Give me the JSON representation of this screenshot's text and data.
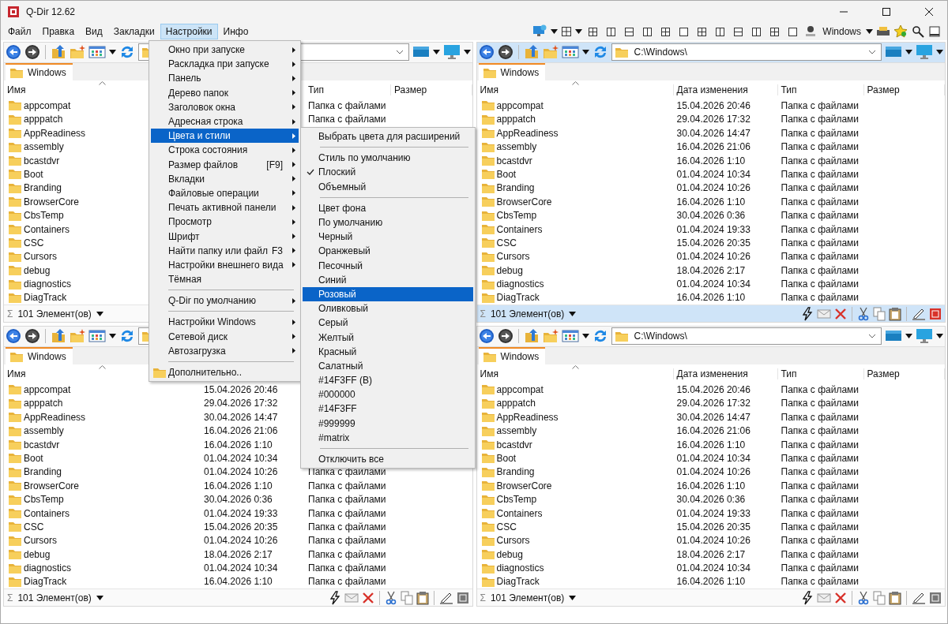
{
  "window": {
    "title": "Q-Dir 12.62"
  },
  "menu_bar": [
    {
      "label": "Файл",
      "selected": false
    },
    {
      "label": "Правка",
      "selected": false
    },
    {
      "label": "Вид",
      "selected": false
    },
    {
      "label": "Закладки",
      "selected": false
    },
    {
      "label": "Настройки",
      "selected": true
    },
    {
      "label": "Инфо",
      "selected": false
    }
  ],
  "toolbar": {
    "profile_label": "Windows"
  },
  "panes": [
    {
      "active": false,
      "tab": "Windows",
      "columns": [
        {
          "kind": "name",
          "label": "Имя"
        },
        {
          "kind": "type",
          "label": "Тип"
        },
        {
          "kind": "size",
          "label": "Размер"
        }
      ],
      "rows": [
        {
          "name": "appcompat",
          "type": "Папка с файлами"
        },
        {
          "name": "apppatch",
          "type": "Папка с файлами"
        },
        {
          "name": "AppReadiness"
        },
        {
          "name": "assembly"
        },
        {
          "name": "bcastdvr"
        },
        {
          "name": "Boot"
        },
        {
          "name": "Branding"
        },
        {
          "name": "BrowserCore"
        },
        {
          "name": "CbsTemp"
        },
        {
          "name": "Containers"
        },
        {
          "name": "CSC"
        },
        {
          "name": "Cursors"
        },
        {
          "name": "debug"
        },
        {
          "name": "diagnostics"
        },
        {
          "name": "DiagTrack"
        }
      ],
      "status_symbol": "Σ",
      "status": "101 Элемент(ов)"
    },
    {
      "active": true,
      "tab": "Windows",
      "address": "C:\\Windows\\",
      "columns": [
        {
          "kind": "name",
          "label": "Имя"
        },
        {
          "kind": "modified",
          "label": "Дата изменения"
        },
        {
          "kind": "type",
          "label": "Тип"
        },
        {
          "kind": "size",
          "label": "Размер"
        }
      ],
      "rows": [
        {
          "name": "appcompat",
          "modified": "15.04.2026 20:46",
          "type": "Папка с файлами"
        },
        {
          "name": "apppatch",
          "modified": "29.04.2026 17:32",
          "type": "Папка с файлами"
        },
        {
          "name": "AppReadiness",
          "modified": "30.04.2026 14:47",
          "type": "Папка с файлами"
        },
        {
          "name": "assembly",
          "modified": "16.04.2026 21:06",
          "type": "Папка с файлами"
        },
        {
          "name": "bcastdvr",
          "modified": "16.04.2026 1:10",
          "type": "Папка с файлами"
        },
        {
          "name": "Boot",
          "modified": "01.04.2024 10:34",
          "type": "Папка с файлами"
        },
        {
          "name": "Branding",
          "modified": "01.04.2024 10:26",
          "type": "Папка с файлами"
        },
        {
          "name": "BrowserCore",
          "modified": "16.04.2026 1:10",
          "type": "Папка с файлами"
        },
        {
          "name": "CbsTemp",
          "modified": "30.04.2026 0:36",
          "type": "Папка с файлами"
        },
        {
          "name": "Containers",
          "modified": "01.04.2024 19:33",
          "type": "Папка с файлами"
        },
        {
          "name": "CSC",
          "modified": "15.04.2026 20:35",
          "type": "Папка с файлами"
        },
        {
          "name": "Cursors",
          "modified": "01.04.2024 10:26",
          "type": "Папка с файлами"
        },
        {
          "name": "debug",
          "modified": "18.04.2026 2:17",
          "type": "Папка с файлами"
        },
        {
          "name": "diagnostics",
          "modified": "01.04.2024 10:34",
          "type": "Папка с файлами"
        },
        {
          "name": "DiagTrack",
          "modified": "16.04.2026 1:10",
          "type": "Папка с файлами"
        }
      ],
      "status_symbol": "Σ",
      "status": "101 Элемент(ов)"
    },
    {
      "active": false,
      "tab": "Windows",
      "columns": [
        {
          "kind": "name",
          "label": "Имя"
        }
      ],
      "rows": [
        {
          "name": "appcompat",
          "modified": "15.04.2026 20:46"
        },
        {
          "name": "apppatch",
          "modified": "29.04.2026 17:32"
        },
        {
          "name": "AppReadiness",
          "modified": "30.04.2026 14:47"
        },
        {
          "name": "assembly",
          "modified": "16.04.2026 21:06"
        },
        {
          "name": "bcastdvr",
          "modified": "16.04.2026 1:10"
        },
        {
          "name": "Boot",
          "modified": "01.04.2024 10:34"
        },
        {
          "name": "Branding",
          "modified": "01.04.2024 10:26",
          "type": "Папка с файлами"
        },
        {
          "name": "BrowserCore",
          "modified": "16.04.2026 1:10",
          "type": "Папка с файлами"
        },
        {
          "name": "CbsTemp",
          "modified": "30.04.2026 0:36",
          "type": "Папка с файлами"
        },
        {
          "name": "Containers",
          "modified": "01.04.2024 19:33",
          "type": "Папка с файлами"
        },
        {
          "name": "CSC",
          "modified": "15.04.2026 20:35",
          "type": "Папка с файлами"
        },
        {
          "name": "Cursors",
          "modified": "01.04.2024 10:26",
          "type": "Папка с файлами"
        },
        {
          "name": "debug",
          "modified": "18.04.2026 2:17",
          "type": "Папка с файлами"
        },
        {
          "name": "diagnostics",
          "modified": "01.04.2024 10:34",
          "type": "Папка с файлами"
        },
        {
          "name": "DiagTrack",
          "modified": "16.04.2026 1:10",
          "type": "Папка с файлами"
        }
      ],
      "status_symbol": "Σ",
      "status": "101 Элемент(ов)"
    },
    {
      "active": false,
      "tab": "Windows",
      "address": "C:\\Windows\\",
      "columns": [
        {
          "kind": "name",
          "label": "Имя"
        },
        {
          "kind": "modified",
          "label": "Дата изменения"
        },
        {
          "kind": "type",
          "label": "Тип"
        },
        {
          "kind": "size",
          "label": "Размер"
        }
      ],
      "rows": [
        {
          "name": "appcompat",
          "modified": "15.04.2026 20:46",
          "type": "Папка с файлами"
        },
        {
          "name": "apppatch",
          "modified": "29.04.2026 17:32",
          "type": "Папка с файлами"
        },
        {
          "name": "AppReadiness",
          "modified": "30.04.2026 14:47",
          "type": "Папка с файлами"
        },
        {
          "name": "assembly",
          "modified": "16.04.2026 21:06",
          "type": "Папка с файлами"
        },
        {
          "name": "bcastdvr",
          "modified": "16.04.2026 1:10",
          "type": "Папка с файлами"
        },
        {
          "name": "Boot",
          "modified": "01.04.2024 10:34",
          "type": "Папка с файлами"
        },
        {
          "name": "Branding",
          "modified": "01.04.2024 10:26",
          "type": "Папка с файлами"
        },
        {
          "name": "BrowserCore",
          "modified": "16.04.2026 1:10",
          "type": "Папка с файлами"
        },
        {
          "name": "CbsTemp",
          "modified": "30.04.2026 0:36",
          "type": "Папка с файлами"
        },
        {
          "name": "Containers",
          "modified": "01.04.2024 19:33",
          "type": "Папка с файлами"
        },
        {
          "name": "CSC",
          "modified": "15.04.2026 20:35",
          "type": "Папка с файлами"
        },
        {
          "name": "Cursors",
          "modified": "01.04.2024 10:26",
          "type": "Папка с файлами"
        },
        {
          "name": "debug",
          "modified": "18.04.2026 2:17",
          "type": "Папка с файлами"
        },
        {
          "name": "diagnostics",
          "modified": "01.04.2024 10:34",
          "type": "Папка с файлами"
        },
        {
          "name": "DiagTrack",
          "modified": "16.04.2026 1:10",
          "type": "Папка с файлами"
        }
      ],
      "status_symbol": "Σ",
      "status": "101 Элемент(ов)"
    }
  ],
  "settings_menu": [
    {
      "kind": "item",
      "label": "Окно при запуске",
      "submenu": true,
      "selected": false
    },
    {
      "kind": "item",
      "label": "Раскладка при запуске",
      "submenu": true,
      "selected": false
    },
    {
      "kind": "item",
      "label": "Панель",
      "submenu": true,
      "selected": false
    },
    {
      "kind": "item",
      "label": "Дерево папок",
      "submenu": true,
      "selected": false
    },
    {
      "kind": "item",
      "label": "Заголовок окна",
      "submenu": true,
      "selected": false
    },
    {
      "kind": "item",
      "label": "Адресная строка",
      "submenu": true,
      "selected": false
    },
    {
      "kind": "item",
      "label": "Цвета и стили",
      "submenu": true,
      "selected": true
    },
    {
      "kind": "item",
      "label": "Строка состояния",
      "submenu": true,
      "selected": false
    },
    {
      "kind": "item",
      "label": "Размер файлов",
      "shortcut": "[F9]",
      "submenu": true,
      "selected": false
    },
    {
      "kind": "item",
      "label": "Вкладки",
      "submenu": true,
      "selected": false
    },
    {
      "kind": "item",
      "label": "Файловые операции",
      "submenu": true,
      "selected": false
    },
    {
      "kind": "item",
      "label": "Печать активной панели",
      "submenu": true,
      "selected": false
    },
    {
      "kind": "item",
      "label": "Просмотр",
      "submenu": true,
      "selected": false
    },
    {
      "kind": "item",
      "label": "Шрифт",
      "submenu": true,
      "selected": false
    },
    {
      "kind": "item",
      "label": "Найти папку или файл",
      "shortcut": "F3",
      "submenu": true,
      "selected": false
    },
    {
      "kind": "item",
      "label": "Настройки внешнего вида",
      "submenu": true,
      "selected": false
    },
    {
      "kind": "item",
      "label": "Тёмная",
      "submenu": false,
      "selected": false
    },
    {
      "kind": "separator"
    },
    {
      "kind": "item",
      "label": "Q-Dir по умолчанию",
      "submenu": true,
      "selected": false
    },
    {
      "kind": "separator"
    },
    {
      "kind": "item",
      "label": "Настройки Windows",
      "submenu": true,
      "selected": false
    },
    {
      "kind": "item",
      "label": "Сетевой диск",
      "submenu": true,
      "selected": false
    },
    {
      "kind": "item",
      "label": "Автозагрузка",
      "submenu": true,
      "selected": false
    },
    {
      "kind": "separator"
    },
    {
      "kind": "folder_item",
      "label": "Дополнительно..",
      "submenu": false,
      "selected": false
    }
  ],
  "colors_submenu": [
    {
      "kind": "item",
      "label": "Выбрать цвета для расширений",
      "checked": false,
      "selected": false
    },
    {
      "kind": "separator"
    },
    {
      "kind": "item",
      "label": "Стиль по умолчанию",
      "checked": false,
      "selected": false
    },
    {
      "kind": "item",
      "label": "Плоский",
      "checked": true,
      "selected": false
    },
    {
      "kind": "item",
      "label": "Объемный",
      "checked": false,
      "selected": false
    },
    {
      "kind": "separator"
    },
    {
      "kind": "item",
      "label": "Цвет фона",
      "checked": false,
      "selected": false
    },
    {
      "kind": "item",
      "label": "По умолчанию",
      "checked": false,
      "selected": false
    },
    {
      "kind": "item",
      "label": "Черный",
      "checked": false,
      "selected": false
    },
    {
      "kind": "item",
      "label": "Оранжевый",
      "checked": false,
      "selected": false
    },
    {
      "kind": "item",
      "label": "Песочный",
      "checked": false,
      "selected": false
    },
    {
      "kind": "item",
      "label": "Синий",
      "checked": false,
      "selected": false
    },
    {
      "kind": "item",
      "label": "Розовый",
      "checked": false,
      "selected": true
    },
    {
      "kind": "item",
      "label": "Оливковый",
      "checked": false,
      "selected": false
    },
    {
      "kind": "item",
      "label": "Серый",
      "checked": false,
      "selected": false
    },
    {
      "kind": "item",
      "label": "Желтый",
      "checked": false,
      "selected": false
    },
    {
      "kind": "item",
      "label": "Красный",
      "checked": false,
      "selected": false
    },
    {
      "kind": "item",
      "label": "Салатный",
      "checked": false,
      "selected": false
    },
    {
      "kind": "item",
      "label": "#14F3FF (B)",
      "checked": false,
      "selected": false
    },
    {
      "kind": "item",
      "label": "#000000",
      "checked": false,
      "selected": false
    },
    {
      "kind": "item",
      "label": "#14F3FF",
      "checked": false,
      "selected": false
    },
    {
      "kind": "item",
      "label": "#999999",
      "checked": false,
      "selected": false
    },
    {
      "kind": "item",
      "label": "#matrix",
      "checked": false,
      "selected": false
    },
    {
      "kind": "separator"
    },
    {
      "kind": "item",
      "label": "Отключить все",
      "checked": false,
      "selected": false
    }
  ]
}
